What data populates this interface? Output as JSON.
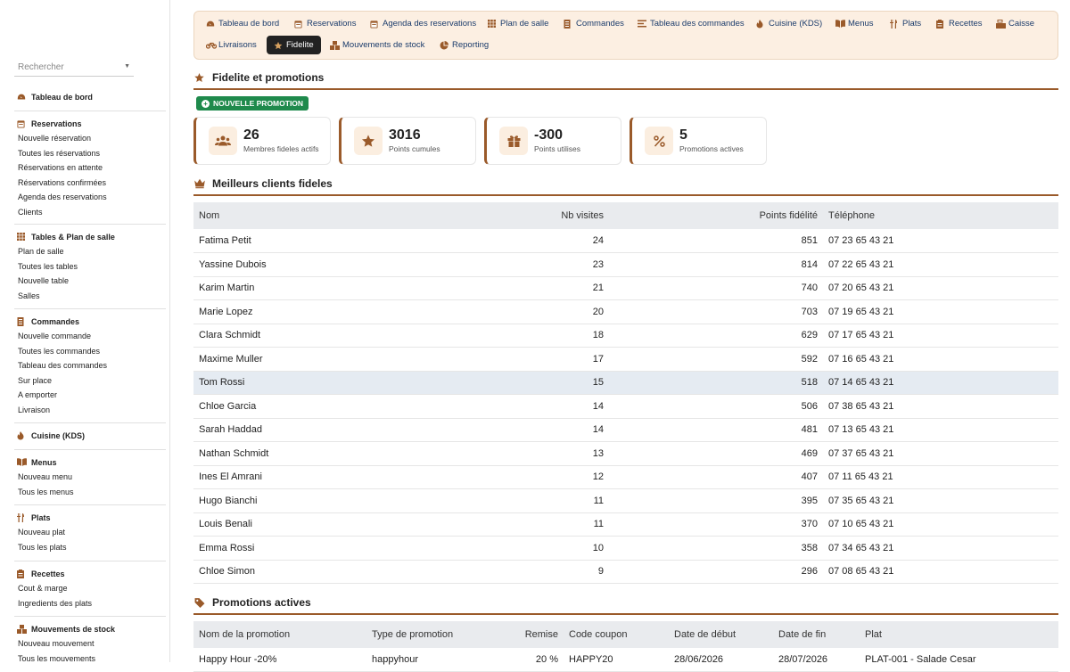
{
  "sidebar": {
    "search_placeholder": "Rechercher",
    "sections": [
      {
        "title": "Tableau de bord",
        "icon": "gauge-icon",
        "items": []
      },
      {
        "title": "Reservations",
        "icon": "calendar-icon",
        "items": [
          "Nouvelle réservation",
          "Toutes les réservations",
          "Réservations en attente",
          "Réservations confirmées",
          "Agenda des reservations",
          "Clients"
        ]
      },
      {
        "title": "Tables & Plan de salle",
        "icon": "grid-icon",
        "items": [
          "Plan de salle",
          "Toutes les tables",
          "Nouvelle table",
          "Salles"
        ]
      },
      {
        "title": "Commandes",
        "icon": "receipt-icon",
        "items": [
          "Nouvelle commande",
          "Toutes les commandes",
          "Tableau des commandes",
          "Sur place",
          "A emporter",
          "Livraison"
        ]
      },
      {
        "title": "Cuisine (KDS)",
        "icon": "flame-icon",
        "items": []
      },
      {
        "title": "Menus",
        "icon": "book-icon",
        "items": [
          "Nouveau menu",
          "Tous les menus"
        ]
      },
      {
        "title": "Plats",
        "icon": "utensils-icon",
        "items": [
          "Nouveau plat",
          "Tous les plats"
        ]
      },
      {
        "title": "Recettes",
        "icon": "recipe-icon",
        "items": [
          "Cout & marge",
          "Ingredients des plats"
        ]
      },
      {
        "title": "Mouvements de stock",
        "icon": "boxes-icon",
        "items": [
          "Nouveau mouvement",
          "Tous les mouvements"
        ]
      }
    ]
  },
  "topnav": {
    "row1": [
      {
        "label": "Tableau de bord",
        "icon": "gauge-icon"
      },
      {
        "label": "Reservations",
        "icon": "calendar-icon"
      },
      {
        "label": "Agenda des reservations",
        "icon": "calendar-icon"
      },
      {
        "label": "Plan de salle",
        "icon": "grid-icon"
      },
      {
        "label": "Commandes",
        "icon": "receipt-icon"
      },
      {
        "label": "Tableau des commandes",
        "icon": "list-icon"
      },
      {
        "label": "Cuisine (KDS)",
        "icon": "flame-icon"
      },
      {
        "label": "Menus",
        "icon": "book-icon"
      },
      {
        "label": "Plats",
        "icon": "utensils-icon"
      },
      {
        "label": "Recettes",
        "icon": "recipe-icon"
      },
      {
        "label": "Caisse",
        "icon": "register-icon"
      }
    ],
    "row2": [
      {
        "label": "Livraisons",
        "icon": "bike-icon"
      },
      {
        "label": "Fidelite",
        "icon": "star-icon",
        "active": true
      },
      {
        "label": "Mouvements de stock",
        "icon": "boxes-icon"
      },
      {
        "label": "Reporting",
        "icon": "pie-icon"
      }
    ]
  },
  "page": {
    "title": "Fidelite et promotions",
    "new_promo_label": "NOUVELLE PROMOTION"
  },
  "stats": [
    {
      "value": "26",
      "label": "Membres fideles actifs",
      "icon": "users-icon"
    },
    {
      "value": "3016",
      "label": "Points cumules",
      "icon": "star-icon"
    },
    {
      "value": "-300",
      "label": "Points utilises",
      "icon": "gift-icon"
    },
    {
      "value": "5",
      "label": "Promotions actives",
      "icon": "percent-icon"
    }
  ],
  "best_clients": {
    "title": "Meilleurs clients fideles",
    "columns": [
      "Nom",
      "Nb visites",
      "Points fidélité",
      "Téléphone"
    ],
    "rows": [
      [
        "Fatima Petit",
        "24",
        "851",
        "07 23 65 43 21"
      ],
      [
        "Yassine Dubois",
        "23",
        "814",
        "07 22 65 43 21"
      ],
      [
        "Karim Martin",
        "21",
        "740",
        "07 20 65 43 21"
      ],
      [
        "Marie Lopez",
        "20",
        "703",
        "07 19 65 43 21"
      ],
      [
        "Clara Schmidt",
        "18",
        "629",
        "07 17 65 43 21"
      ],
      [
        "Maxime Muller",
        "17",
        "592",
        "07 16 65 43 21"
      ],
      [
        "Tom Rossi",
        "15",
        "518",
        "07 14 65 43 21"
      ],
      [
        "Chloe Garcia",
        "14",
        "506",
        "07 38 65 43 21"
      ],
      [
        "Sarah Haddad",
        "14",
        "481",
        "07 13 65 43 21"
      ],
      [
        "Nathan Schmidt",
        "13",
        "469",
        "07 37 65 43 21"
      ],
      [
        "Ines El Amrani",
        "12",
        "407",
        "07 11 65 43 21"
      ],
      [
        "Hugo Bianchi",
        "11",
        "395",
        "07 35 65 43 21"
      ],
      [
        "Louis Benali",
        "11",
        "370",
        "07 10 65 43 21"
      ],
      [
        "Emma Rossi",
        "10",
        "358",
        "07 34 65 43 21"
      ],
      [
        "Chloe Simon",
        "9",
        "296",
        "07 08 65 43 21"
      ]
    ]
  },
  "promotions": {
    "title": "Promotions actives",
    "columns": [
      "Nom de la promotion",
      "Type de promotion",
      "Remise",
      "Code coupon",
      "Date de début",
      "Date de fin",
      "Plat"
    ],
    "rows": [
      [
        "Happy Hour -20%",
        "happyhour",
        "20 %",
        "HAPPY20",
        "28/06/2026",
        "28/07/2026",
        "PLAT-001 - Salade Cesar"
      ]
    ]
  },
  "colors": {
    "accent": "#9a5a2a",
    "nav_bg": "#fcefe2",
    "promo_button": "#1f8a4c",
    "link": "#1a3b6b"
  }
}
